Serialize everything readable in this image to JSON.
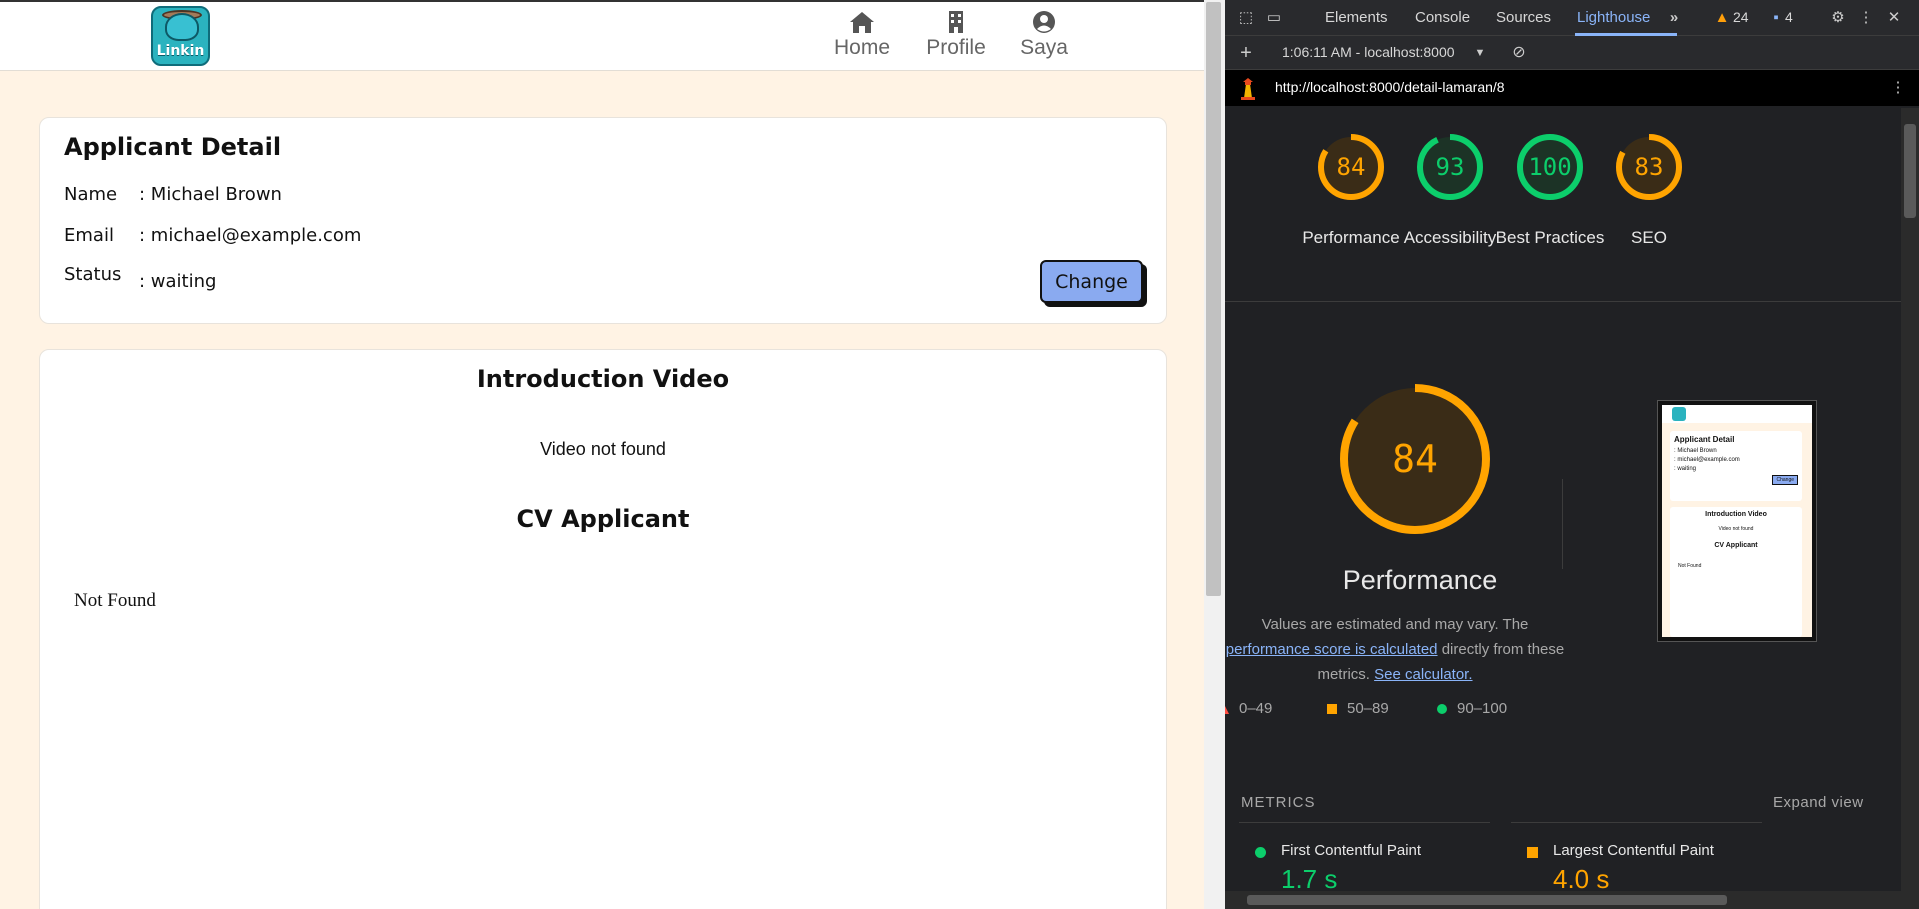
{
  "app": {
    "logo_text": "Linkin",
    "nav": [
      {
        "label": "Home",
        "icon": "home-icon"
      },
      {
        "label": "Profile",
        "icon": "building-icon"
      },
      {
        "label": "Saya",
        "icon": "user-circle-icon"
      }
    ],
    "detail": {
      "title": "Applicant Detail",
      "name_label": "Name",
      "name_value": ": Michael Brown",
      "email_label": "Email",
      "email_value": ": michael@example.com",
      "status_label": "Status",
      "status_value": ": waiting",
      "change_label": "Change"
    },
    "video": {
      "title": "Introduction Video",
      "message": "Video not found"
    },
    "cv": {
      "title": "CV Applicant",
      "message": "Not Found"
    },
    "colors": {
      "background": "#fff3e4",
      "button": "#8aaaf0"
    }
  },
  "devtools": {
    "tabs": [
      "Elements",
      "Console",
      "Sources",
      "Lighthouse"
    ],
    "active_tab": "Lighthouse",
    "warnings_count": "24",
    "messages_count": "4",
    "report_time": "1:06:11 AM - localhost:8000",
    "url": "http://localhost:8000/detail-lamaran/8",
    "scores": [
      {
        "label": "Performance",
        "score": 84,
        "color": "#ffa400"
      },
      {
        "label": "Accessibility",
        "score": 93,
        "color": "#0cce6b"
      },
      {
        "label": "Best Practices",
        "score": 100,
        "color": "#0cce6b"
      },
      {
        "label": "SEO",
        "score": 83,
        "color": "#ffa400"
      }
    ],
    "perf": {
      "score": 84,
      "title": "Performance",
      "desc_line1": "Values are estimated and may vary. The",
      "desc_link1": "performance score is calculated",
      "desc_mid": "directly from these",
      "desc_pre": "metrics.",
      "desc_link2": "See calculator."
    },
    "legend": [
      {
        "range": "0–49",
        "color": "#ff4e42"
      },
      {
        "range": "50–89",
        "color": "#ffa400"
      },
      {
        "range": "90–100",
        "color": "#0cce6b"
      }
    ],
    "metrics_header": "METRICS",
    "expand_view": "Expand view",
    "metrics": [
      {
        "name": "First Contentful Paint",
        "value": "1.7 s",
        "color": "#0cce6b"
      },
      {
        "name": "Largest Contentful Paint",
        "value": "4.0 s",
        "color": "#ffa400"
      }
    ],
    "thumbnail": {
      "title": "Applicant Detail",
      "name": ": Michael Brown",
      "email": ": michael@example.com",
      "status": ": waiting",
      "change": "Change",
      "video_title": "Introduction Video",
      "video_msg": "Video not found",
      "cv_title": "CV Applicant",
      "cv_msg": "Not Found"
    }
  }
}
